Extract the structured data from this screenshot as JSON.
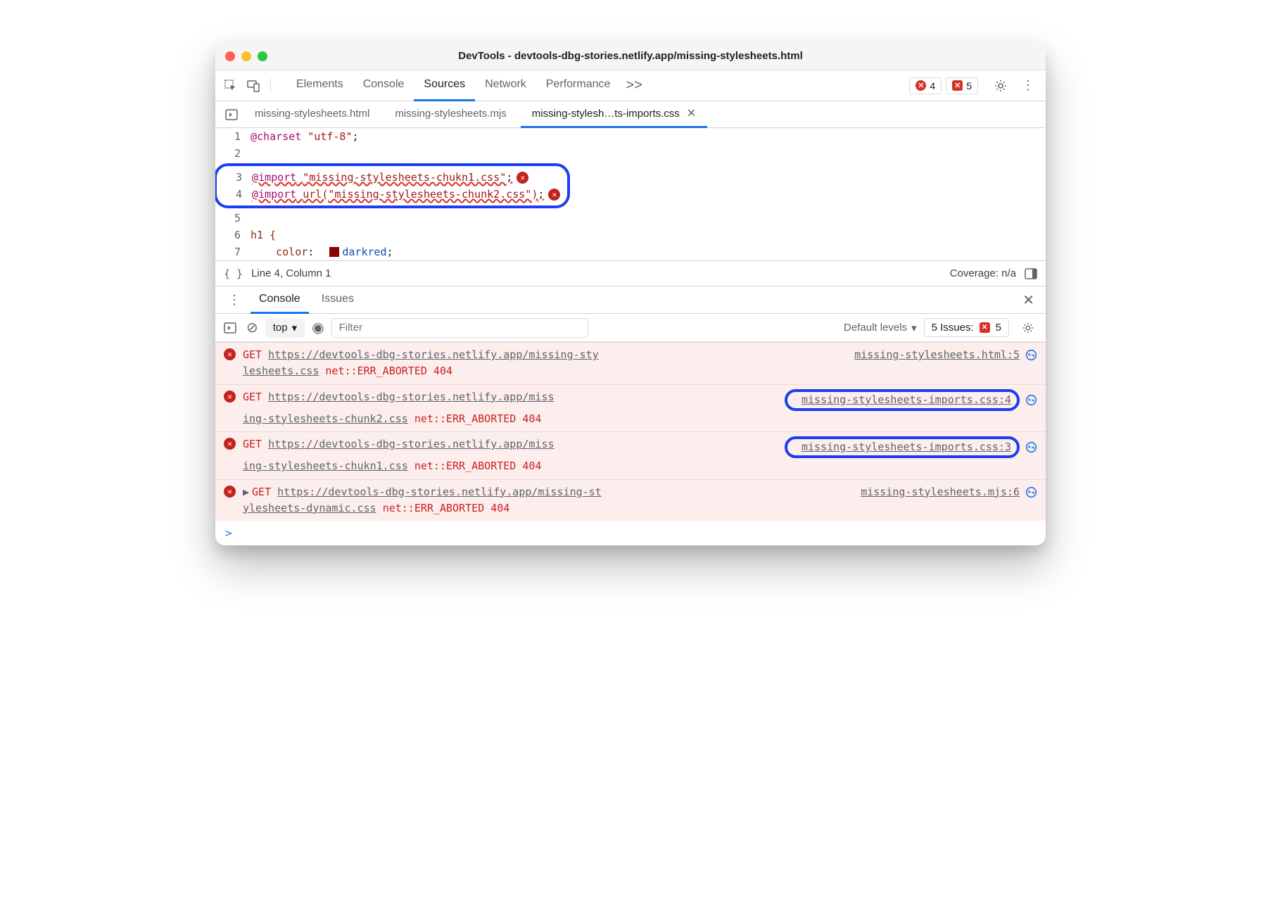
{
  "window": {
    "title": "DevTools - devtools-dbg-stories.netlify.app/missing-stylesheets.html"
  },
  "panels": {
    "tabs": [
      "Elements",
      "Console",
      "Sources",
      "Network",
      "Performance"
    ],
    "active": "Sources",
    "more": ">>",
    "errorBadge": "4",
    "issueBadge": "5"
  },
  "fileTabs": {
    "items": [
      {
        "label": "missing-stylesheets.html",
        "active": false
      },
      {
        "label": "missing-stylesheets.mjs",
        "active": false
      },
      {
        "label": "missing-stylesh…ts-imports.css",
        "active": true
      }
    ]
  },
  "editor": {
    "l1_kw": "@charset",
    "l1_sp": " ",
    "l1_str": "\"utf-8\"",
    "l1_p": ";",
    "l3_kw": "@import",
    "l3_sp": " ",
    "l3_str": "\"missing-stylesheets-chukn1.css\"",
    "l3_p": ";",
    "l4_kw": "@import",
    "l4_sp": " ",
    "l4_fn": "url(",
    "l4_str": "\"missing-stylesheets-chunk2.css\"",
    "l4_fnend": ")",
    "l4_p": ";",
    "l6": "h1 {",
    "l7_prop": "    color",
    "l7_colon": ":  ",
    "l7_val": "darkred",
    "l7_p": ";",
    "ln": {
      "1": "1",
      "2": "2",
      "3": "3",
      "4": "4",
      "5": "5",
      "6": "6",
      "7": "7"
    }
  },
  "status": {
    "pos": "Line 4, Column 1",
    "cov": "Coverage: n/a"
  },
  "drawer": {
    "tabs": [
      "Console",
      "Issues"
    ],
    "active": "Console"
  },
  "consoleToolbar": {
    "context": "top",
    "filterPlaceholder": "Filter",
    "levels": "Default levels",
    "issuesLabel": "5 Issues:",
    "issuesCount": "5"
  },
  "console": {
    "msgs": [
      {
        "method": "GET",
        "url1": "https://devtools-dbg-stories.netlify.app/missing-sty",
        "url2": "lesheets.css",
        "err": "net::ERR_ABORTED 404",
        "src": "missing-stylesheets.html:5",
        "srcBox": false,
        "expand": false
      },
      {
        "method": "GET",
        "url1": "https://devtools-dbg-stories.netlify.app/miss",
        "url2": "ing-stylesheets-chunk2.css",
        "err": "net::ERR_ABORTED 404",
        "src": "missing-stylesheets-imports.css:4",
        "srcBox": true,
        "expand": false
      },
      {
        "method": "GET",
        "url1": "https://devtools-dbg-stories.netlify.app/miss",
        "url2": "ing-stylesheets-chukn1.css",
        "err": "net::ERR_ABORTED 404",
        "src": "missing-stylesheets-imports.css:3",
        "srcBox": true,
        "expand": false
      },
      {
        "method": "GET",
        "url1": "https://devtools-dbg-stories.netlify.app/missing-st",
        "url2": "ylesheets-dynamic.css",
        "err": "net::ERR_ABORTED 404",
        "src": "missing-stylesheets.mjs:6",
        "srcBox": false,
        "expand": true
      }
    ],
    "prompt": ">"
  }
}
